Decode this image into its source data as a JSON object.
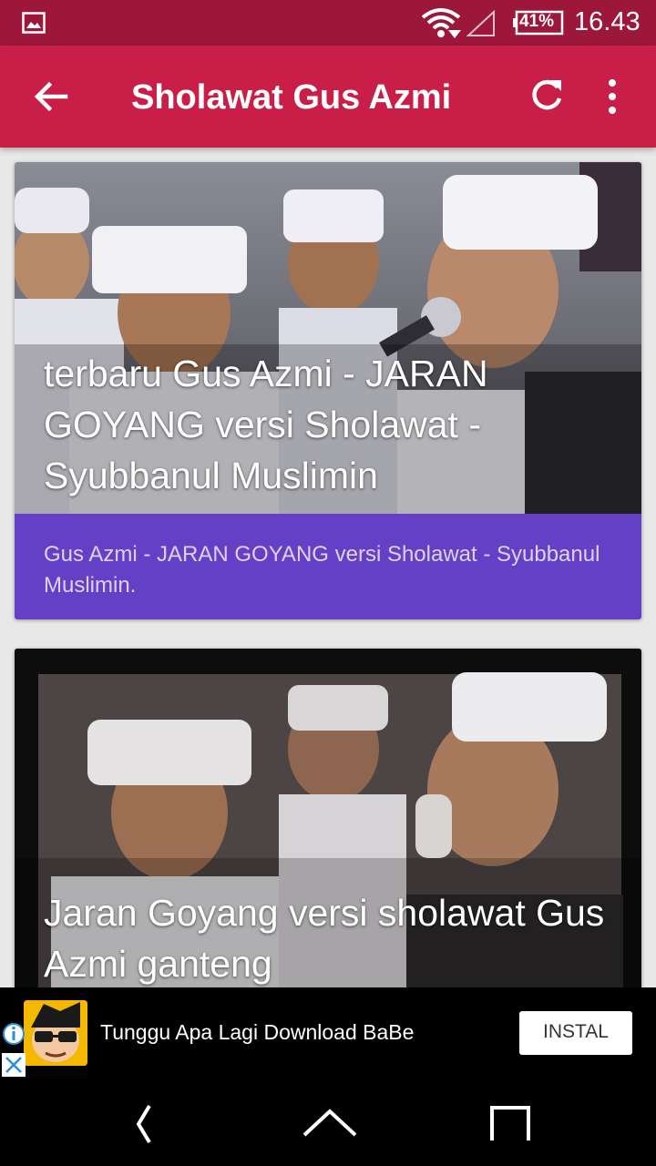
{
  "status_bar": {
    "battery": "41%",
    "time": "16.43"
  },
  "app_bar": {
    "title": "Sholawat Gus Azmi"
  },
  "cards": [
    {
      "title": "terbaru Gus Azmi - JARAN GOYANG versi Sholawat - Syubbanul Muslimin",
      "description": "Gus Azmi - JARAN GOYANG versi Sholawat - Syubbanul Muslimin."
    },
    {
      "title": "Jaran Goyang versi sholawat Gus Azmi ganteng",
      "description": ""
    }
  ],
  "ad": {
    "text": "Tunggu Apa Lagi Download BaBe",
    "button": "INSTAL"
  },
  "colors": {
    "status_bar": "#9c1739",
    "app_bar": "#c81e47",
    "card_description": "#6440c6"
  }
}
